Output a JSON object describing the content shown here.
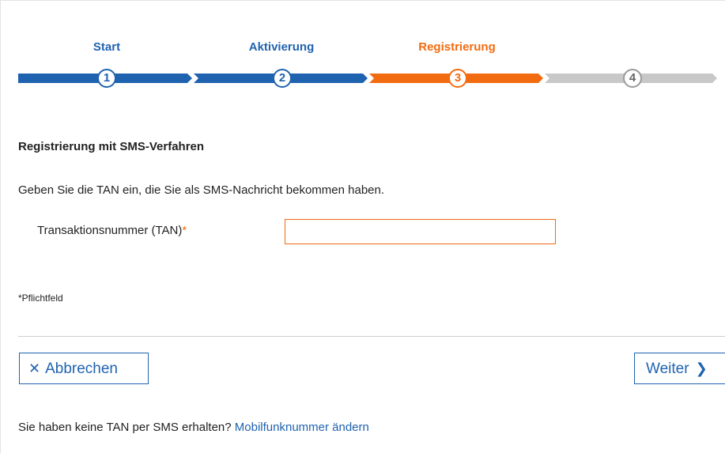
{
  "stepper": {
    "steps": [
      {
        "label": "Start",
        "number": "1",
        "state": "done"
      },
      {
        "label": "Aktivierung",
        "number": "2",
        "state": "done"
      },
      {
        "label": "Registrierung",
        "number": "3",
        "state": "active"
      },
      {
        "label": "",
        "number": "4",
        "state": "pending"
      }
    ],
    "colors": {
      "done": "#1f63b0",
      "active": "#f26b10",
      "pending": "#c8c8c8"
    }
  },
  "form": {
    "title": "Registrierung mit SMS-Verfahren",
    "instruction": "Geben Sie die TAN ein, die Sie als SMS-Nachricht bekommen haben.",
    "tan_label": "Transaktionsnummer (TAN)",
    "required_marker": "*",
    "tan_value": "",
    "mandatory_note": "*Pflichtfeld"
  },
  "actions": {
    "cancel_label": "Abbrechen",
    "cancel_icon": "close-icon",
    "next_label": "Weiter",
    "next_icon": "chevron-right-icon"
  },
  "footer": {
    "question": "Sie haben keine TAN per SMS erhalten?",
    "link_label": "Mobilfunknummer ändern"
  }
}
